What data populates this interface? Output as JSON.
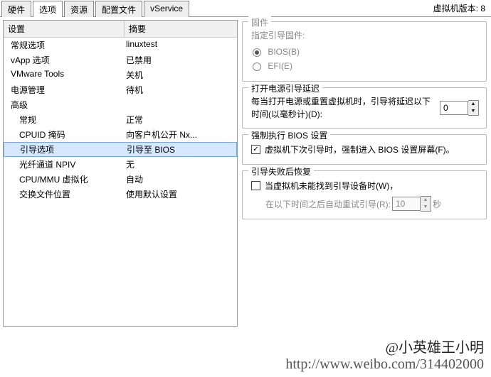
{
  "tabs": [
    "硬件",
    "选项",
    "资源",
    "配置文件",
    "vService"
  ],
  "version_label": "虚拟机版本: 8",
  "list_header": {
    "col1": "设置",
    "col2": "摘要"
  },
  "rows": [
    {
      "c1": "常规选项",
      "c2": "linuxtest",
      "indent": false
    },
    {
      "c1": "vApp 选项",
      "c2": "已禁用",
      "indent": false
    },
    {
      "c1": "VMware Tools",
      "c2": "关机",
      "indent": false
    },
    {
      "c1": "电源管理",
      "c2": "待机",
      "indent": false
    }
  ],
  "group_label": "高级",
  "adv_rows": [
    {
      "c1": "常规",
      "c2": "正常"
    },
    {
      "c1": "CPUID 掩码",
      "c2": "向客户机公开 Nx..."
    },
    {
      "c1": "引导选项",
      "c2": "引导至 BIOS",
      "selected": true
    },
    {
      "c1": "光纤通道 NPIV",
      "c2": "无"
    },
    {
      "c1": "CPU/MMU 虚拟化",
      "c2": "自动"
    },
    {
      "c1": "交换文件位置",
      "c2": "使用默认设置"
    }
  ],
  "firmware": {
    "legend": "固件",
    "specify": "指定引导固件:",
    "bios": "BIOS(B)",
    "efi": "EFI(E)"
  },
  "delay": {
    "legend": "打开电源引导延迟",
    "text": "每当打开电源或重置虚拟机时，引导将延迟以下时间(以毫秒计)(D):",
    "value": "0"
  },
  "force": {
    "legend": "强制执行 BIOS 设置",
    "text": "虚拟机下次引导时，强制进入 BIOS 设置屏幕(F)。",
    "checked": true
  },
  "recovery": {
    "legend": "引导失败后恢复",
    "text": "当虚拟机未能找到引导设备时(W)，",
    "retry_prefix": "在以下时间之后自动重试引导(R):",
    "retry_value": "10",
    "retry_suffix": "秒",
    "checked": false
  },
  "watermark": {
    "name": "@小英雄王小明",
    "url": "http://www.weibo.com/314402000"
  }
}
